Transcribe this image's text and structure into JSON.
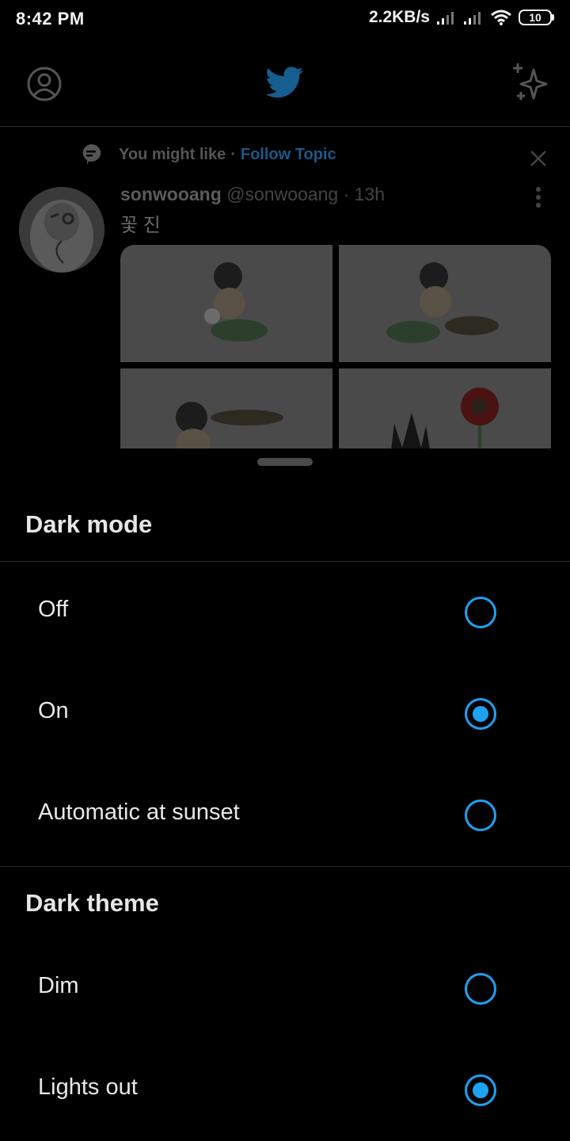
{
  "status_bar": {
    "time": "8:42 PM",
    "net_speed": "2.2KB/s",
    "battery": "10"
  },
  "background_feed": {
    "suggestion_label": "You might like",
    "suggestion_separator": "·",
    "follow_topic_label": "Follow Topic",
    "tweet": {
      "display_name": "sonwooang",
      "handle": "@sonwooang",
      "separator": "·",
      "time": "13h",
      "text": "꽃 진"
    }
  },
  "sheet": {
    "dark_mode_title": "Dark mode",
    "dark_mode_options": [
      {
        "label": "Off",
        "selected": false
      },
      {
        "label": "On",
        "selected": true
      },
      {
        "label": "Automatic at sunset",
        "selected": false
      }
    ],
    "dark_theme_title": "Dark theme",
    "dark_theme_options": [
      {
        "label": "Dim",
        "selected": false
      },
      {
        "label": "Lights out",
        "selected": true
      }
    ]
  },
  "colors": {
    "accent": "#1da1f2",
    "background": "#000000"
  }
}
